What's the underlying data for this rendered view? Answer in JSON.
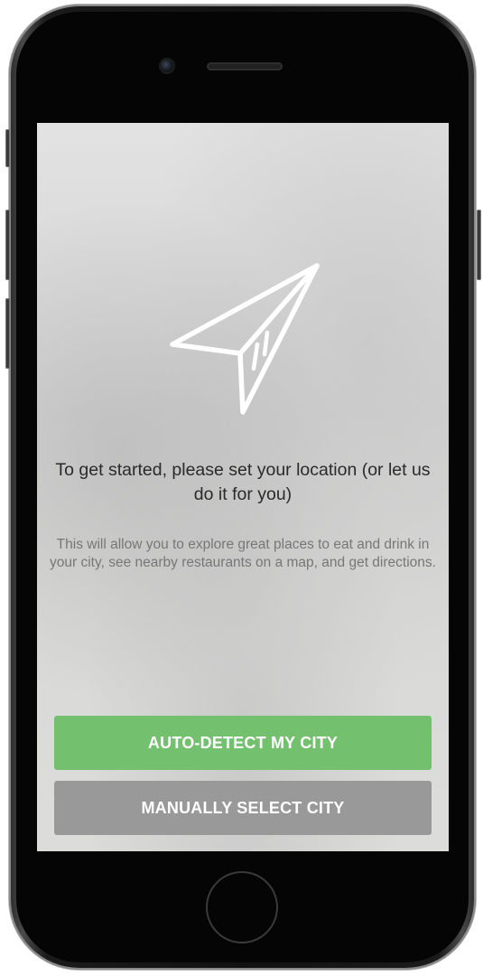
{
  "screen": {
    "headline": "To get started, please set your location (or let us do it for you)",
    "description": "This will allow you to explore great places to eat and drink in your city, see nearby restaurants on a map, and get directions.",
    "icon": "location-arrow-icon"
  },
  "actions": {
    "auto_detect_label": "AUTO-DETECT MY CITY",
    "manual_select_label": "MANUALLY SELECT CITY"
  },
  "colors": {
    "primary_button": "#73c16f",
    "secondary_button": "#999999",
    "headline_text": "#2a2a2a",
    "description_text": "#777777"
  }
}
